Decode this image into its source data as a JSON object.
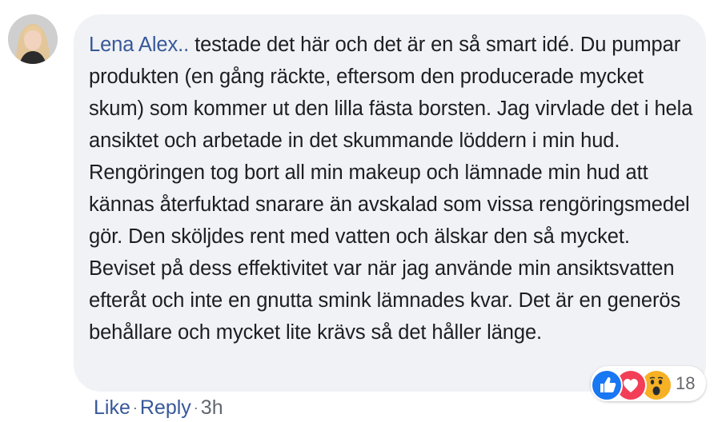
{
  "comment": {
    "author": "Lena Alex..",
    "text": " testade det här och det är en så smart idé. Du pumpar produkten (en gång räckte, eftersom den producerade mycket skum) som kommer ut den lilla fästa borsten. Jag virvlade det i hela ansiktet och arbetade in det skummande löddern i min hud. Rengöringen tog bort all min makeup och lämnade min hud att kännas återfuktad snarare än avskalad som vissa rengöringsmedel gör. Den sköljdes rent med vatten och älskar den så mycket. Beviset på dess effektivitet var när jag använde min ansiktsvatten efteråt och inte en gnutta smink lämnades kvar. Det är en generös behållare och mycket lite krävs så det håller länge.",
    "reactions": {
      "icons": [
        "like-icon",
        "love-icon",
        "wow-icon"
      ],
      "count": "18"
    }
  },
  "actions": {
    "like_label": "Like",
    "reply_label": "Reply",
    "separator": "·",
    "timestamp": "3h"
  },
  "colors": {
    "link": "#385898",
    "bubble_bg": "#f0f2f5",
    "text": "#1c1e21",
    "muted": "#65676b",
    "like_blue": "#1877f2",
    "love_red": "#f33e58",
    "wow_yellow": "#f7b125"
  }
}
